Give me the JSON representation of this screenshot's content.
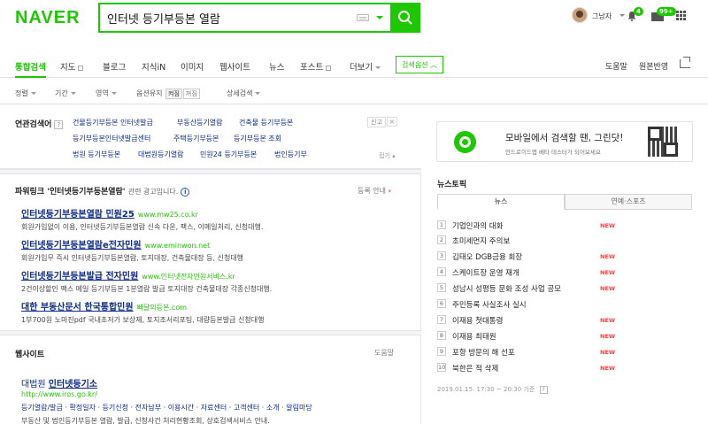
{
  "header": {
    "logo": "NAVER",
    "search_value": "인터넷 등기부등본 열람",
    "username": "그남자",
    "notif_count": "4",
    "mail_count": "99+"
  },
  "nav": {
    "tabs": [
      "통합검색",
      "지도",
      "블로그",
      "지식iN",
      "이미지",
      "웹사이트",
      "뉴스",
      "포스트",
      "더보기"
    ],
    "option": "검색옵션",
    "help": "도움말",
    "original": "원본반영"
  },
  "filters": {
    "sort": "정렬",
    "period": "기간",
    "area": "영역",
    "option_keep": "옵션유지",
    "on": "켜짐",
    "off": "꺼짐",
    "detail": "상세검색"
  },
  "related": {
    "title": "연관검색어",
    "q": "?",
    "report": "신고",
    "close": "×",
    "fold": "접기",
    "row1": [
      "건물등기부등본 인터넷발급",
      "부동산등기열람",
      "건축물 등기부등본"
    ],
    "row2": [
      "등기부등본인터넷발급센터",
      "주택등기부등본",
      "등기부등본 조회"
    ],
    "row3": [
      "법원 등기부등본",
      "대법원등기열람",
      "민원24 등기부등본",
      "법인등기부"
    ]
  },
  "powerlink": {
    "title": "파워링크 '인터넷등기부등본열람'",
    "subtitle": "관련 광고입니다.",
    "info": "i",
    "register": "등록 안내",
    "ads": [
      {
        "title": "인터넷등기부등본열람 민원25",
        "url": "www.mw25.co.kr",
        "desc": "회원가입없이 이용, 인터넷등기부등본열람 신속 다운, 팩스, 이메일처리, 신청대행."
      },
      {
        "title": "인터넷등기부등본열람e전자민원",
        "url": "www.eminwon.net",
        "desc": "회원가입무 즉시 인터넷등기부등본열람, 토지대장, 건축물대장 등, 신청대행"
      },
      {
        "title": "인터넷등기부등본발급 전자민원",
        "url": "www.인터넷전자민원서비스.kr",
        "desc": "2건이상할인 팩스 메일 등기부등본 1분열람 발급 토지대장 건축물대장 각종신청대행."
      },
      {
        "title": "대한 부동산문서 한국통합민원",
        "url": "빠달의등본.com",
        "desc": "1부700원 노마진pdf 국내초저가 보상제, 토지조서리포팅, 대량등본발급 신청대행"
      }
    ]
  },
  "website": {
    "title": "웹사이트",
    "more": "도움말",
    "site_prefix": "대법원",
    "site_name": "인터넷등기소",
    "site_url": "http://www.iros.go.kr/",
    "links": "등기열람/발급 · 확정일자 · 등기신청 · 전자납부 · 이용시간 · 자료센터 · 고객센터 · 소개 · 알림마당",
    "desc": "부동산 및 법인등기부등본 열람, 발급, 신청사건 처리현황조회, 상호검색서비스 안내."
  },
  "banner": {
    "text": "모바일에서 검색할 땐, 그린닷!",
    "sub": "안드로이드앱 베타 테스터가 되어보세요"
  },
  "news": {
    "title": "뉴스토픽",
    "tabs": [
      "뉴스",
      "연예·스포츠"
    ],
    "items": [
      {
        "rank": "1",
        "text": "기업인과의 대화",
        "new": "NEW"
      },
      {
        "rank": "2",
        "text": "초미세먼지 주의보",
        "new": ""
      },
      {
        "rank": "3",
        "text": "김태오 DGB금융 회장",
        "new": "NEW"
      },
      {
        "rank": "4",
        "text": "스케이트장 운영 재개",
        "new": "NEW"
      },
      {
        "rank": "5",
        "text": "성남시 성평등 문화 조성 사업 공모",
        "new": "NEW"
      },
      {
        "rank": "6",
        "text": "주민등록 사실조사 실시",
        "new": ""
      },
      {
        "rank": "7",
        "text": "이재용 첫대통령",
        "new": "NEW"
      },
      {
        "rank": "8",
        "text": "이재용 최태원",
        "new": "NEW"
      },
      {
        "rank": "9",
        "text": "포항 방문의 해 선포",
        "new": "NEW"
      },
      {
        "rank": "10",
        "text": "북한은 적 삭제",
        "new": "NEW"
      }
    ],
    "foot": "2019.01.15. 17:30 ~ 20:30 기준",
    "foot_q": "?"
  },
  "colors": {
    "brand": "#1ec800",
    "link": "#0c2a8c",
    "new": "#f04646"
  }
}
